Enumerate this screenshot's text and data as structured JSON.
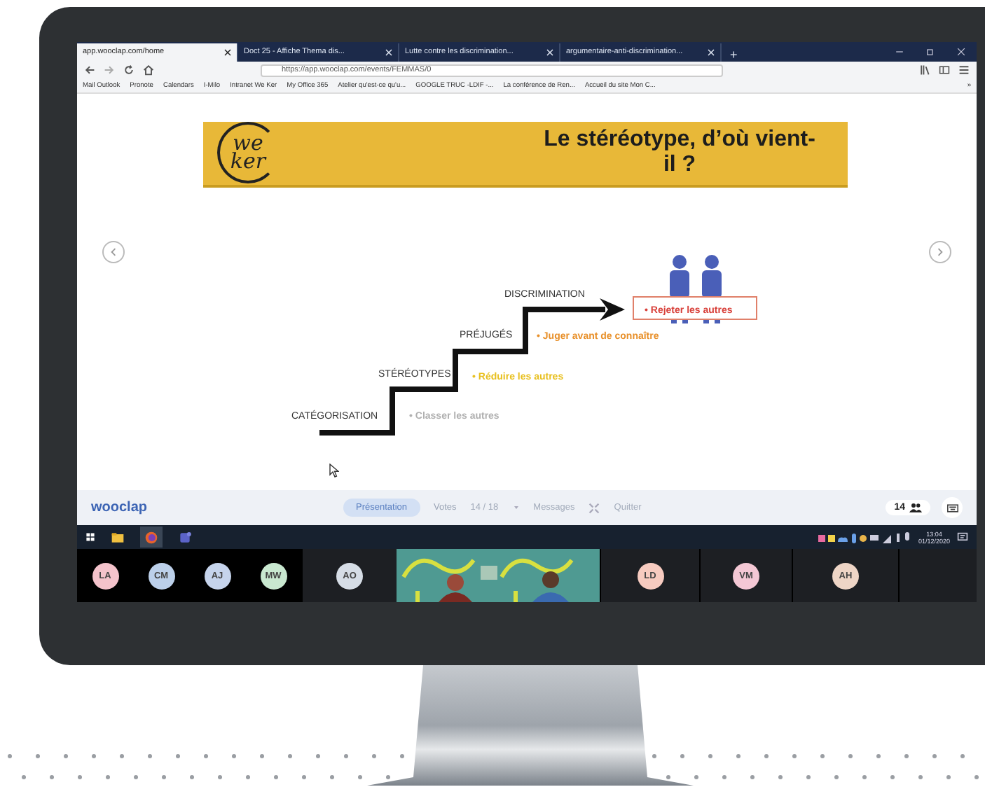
{
  "browser": {
    "tabs": [
      {
        "label": "app.wooclap.com/home",
        "selected": true
      },
      {
        "label": "Doct 25 - Affiche Thema dis...",
        "selected": false
      },
      {
        "label": "Lutte contre les discrimination...",
        "selected": false
      },
      {
        "label": "argumentaire-anti-discrimination...",
        "selected": false
      }
    ],
    "new_tab": "+",
    "url": "https://app.wooclap.com/events/FEMMAS/0",
    "bookmarks": [
      "Mail Outlook",
      "Pronote",
      "Calendars",
      "I-Milo",
      "Intranet We Ker",
      "My Office 365",
      "Atelier qu'est-ce qu'u...",
      "GOOGLE TRUC -LDIF -...",
      "La conférence de Ren...",
      "Accueil du site Mon C..."
    ],
    "bookmarks_more": "»"
  },
  "slide": {
    "logo_top": "we",
    "logo_bottom": "ker",
    "title": "Le stéréotype, d’où vient-il ?",
    "steps": [
      {
        "label": "CATÉGORISATION",
        "action": "• Classer les autres",
        "color": "#b0b0b0"
      },
      {
        "label": "STÉRÉOTYPES",
        "action": "• Réduire les autres",
        "color": "#e8c020"
      },
      {
        "label": "PRÉJUGÉS",
        "action": "• Juger avant de connaître",
        "color": "#e8902a"
      },
      {
        "label": "DISCRIMINATION",
        "action": "• Rejeter les autres",
        "color": "#d8403a"
      }
    ]
  },
  "wooclap_bar": {
    "logo": "wooclap",
    "present": "Présentation",
    "votes_label": "Votes",
    "votes": "14 / 18",
    "messages": "Messages",
    "quit": "Quitter",
    "participants": "14"
  },
  "taskbar": {
    "apps": [
      {
        "kind": "files",
        "selected": false
      },
      {
        "kind": "firefox",
        "selected": true
      },
      {
        "kind": "teams",
        "selected": false
      }
    ],
    "time": "13:04",
    "date": "01/12/2020"
  },
  "participants": [
    {
      "kind": "avatar",
      "initials": "LA",
      "color": "#f4c3cb"
    },
    {
      "kind": "avatar",
      "initials": "CM",
      "color": "#bcd0ea"
    },
    {
      "kind": "avatar",
      "initials": "AJ",
      "color": "#c6d4ec"
    },
    {
      "kind": "avatar",
      "initials": "MW",
      "color": "#c9e8d0"
    },
    {
      "kind": "avatar",
      "initials": "AO",
      "color": "#d6dde6"
    },
    {
      "kind": "picture"
    },
    {
      "kind": "avatar",
      "initials": "LD",
      "color": "#f7cbc0"
    },
    {
      "kind": "avatar",
      "initials": "VM",
      "color": "#f4c8d5"
    },
    {
      "kind": "avatar",
      "initials": "AH",
      "color": "#eed5c6"
    }
  ]
}
